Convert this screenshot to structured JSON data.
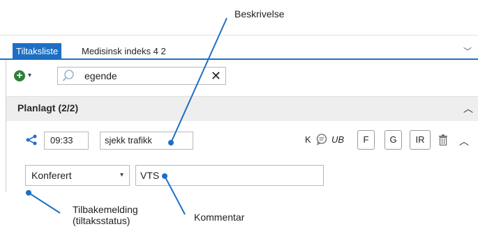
{
  "tabs": [
    {
      "label": "Tiltaksliste",
      "active": true
    },
    {
      "label": "Medisinsk indeks 4 2",
      "active": false
    }
  ],
  "toolbar": {
    "search_value": "egende"
  },
  "section": {
    "title": "Planlagt (2/2)"
  },
  "measure": {
    "time": "09:33",
    "description": "sjekk trafikk",
    "flag_k": "K",
    "flag_ub": "UB",
    "buttons": [
      "F",
      "G",
      "IR"
    ]
  },
  "status": {
    "selected": "Konferert",
    "comment": "VTS"
  },
  "callouts": {
    "beskrivelse": "Beskrivelse",
    "tilbakemelding_line1": "Tilbakemelding",
    "tilbakemelding_line2": "(tiltaksstatus)",
    "kommentar": "Kommentar"
  },
  "colors": {
    "accent": "#1e6fc4",
    "add_green": "#2f7f3a",
    "section_bg": "#eeeeee"
  },
  "icons": [
    "plus-circle-icon",
    "chevron-down-icon",
    "search-icon",
    "close-icon",
    "share-icon",
    "comment-icon",
    "trash-icon",
    "chevron-up-icon"
  ]
}
